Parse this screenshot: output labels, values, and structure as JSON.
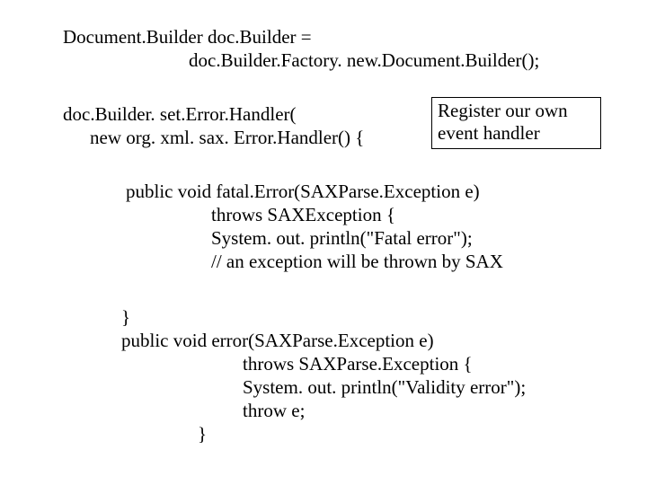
{
  "code": {
    "l1": "Document.Builder doc.Builder =",
    "l2": "doc.Builder.Factory. new.Document.Builder();",
    "l3": "doc.Builder. set.Error.Handler(",
    "l4": "new org. xml. sax. Error.Handler() {",
    "l5": "public void fatal.Error(SAXParse.Exception e)",
    "l6": "throws SAXException {",
    "l7": "System. out. println(\"Fatal error\");",
    "l8": "// an exception will be thrown by SAX",
    "l9": "}",
    "l10": "public void error(SAXParse.Exception e)",
    "l11": "throws SAXParse.Exception {",
    "l12": "System. out. println(\"Validity error\");",
    "l13": "throw e;",
    "l14": "}"
  },
  "callout": {
    "line1": "Register our own",
    "line2": "event handler"
  }
}
